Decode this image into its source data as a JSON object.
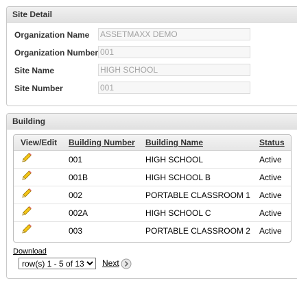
{
  "site_detail": {
    "title": "Site Detail",
    "fields": [
      {
        "label": "Organization Name",
        "value": "ASSETMAXX DEMO"
      },
      {
        "label": "Organization Number",
        "value": "001"
      },
      {
        "label": "Site Name",
        "value": "HIGH SCHOOL"
      },
      {
        "label": "Site Number",
        "value": "001"
      }
    ]
  },
  "building": {
    "title": "Building",
    "columns": {
      "view_edit": "View/Edit",
      "building_number": "Building Number",
      "building_name": "Building Name",
      "status": "Status"
    },
    "rows": [
      {
        "number": "001",
        "name": "HIGH SCHOOL",
        "status": "Active"
      },
      {
        "number": "001B",
        "name": "HIGH SCHOOL B",
        "status": "Active"
      },
      {
        "number": "002",
        "name": "PORTABLE CLASSROOM 1",
        "status": "Active"
      },
      {
        "number": "002A",
        "name": "HIGH SCHOOL C",
        "status": "Active"
      },
      {
        "number": "003",
        "name": "PORTABLE CLASSROOM 2",
        "status": "Active"
      }
    ],
    "download_label": "Download",
    "pagination": {
      "selected": "row(s) 1 - 5 of 13",
      "next_label": "Next"
    }
  },
  "icons": {
    "edit": "pencil-icon",
    "next": "chevron-right-circle-icon"
  }
}
